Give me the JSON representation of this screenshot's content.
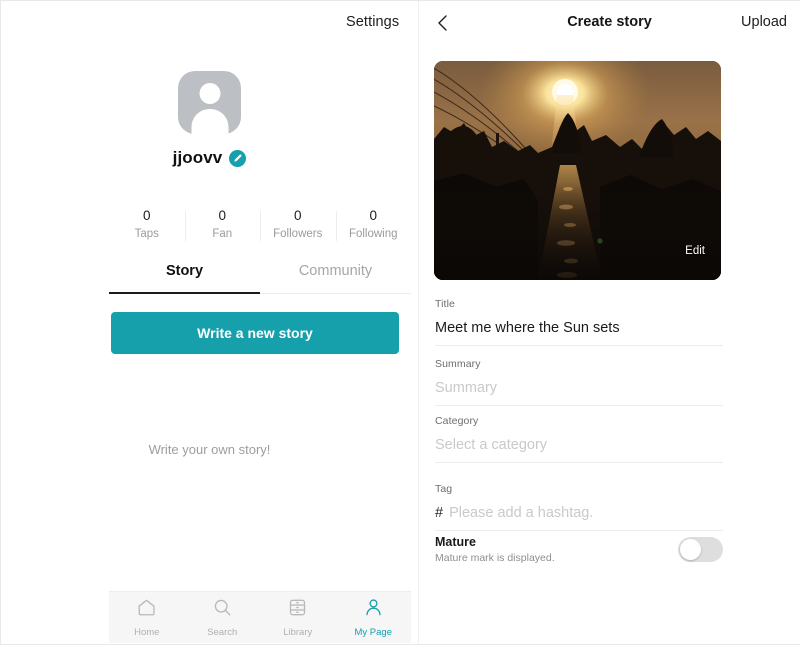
{
  "left": {
    "settings_label": "Settings",
    "profile": {
      "username": "jjoovv",
      "edit_badge_icon": "pencil-icon",
      "avatar_icon": "person-placeholder-icon"
    },
    "stats": [
      {
        "value": "0",
        "label": "Taps"
      },
      {
        "value": "0",
        "label": "Fan"
      },
      {
        "value": "0",
        "label": "Followers"
      },
      {
        "value": "0",
        "label": "Following"
      }
    ],
    "tabs": [
      {
        "label": "Story",
        "active": true
      },
      {
        "label": "Community",
        "active": false
      }
    ],
    "write_story_button": "Write a new story",
    "empty_message": "Write your own story!",
    "bottom_nav": [
      {
        "label": "Home",
        "icon": "home-icon",
        "active": false
      },
      {
        "label": "Search",
        "icon": "search-icon",
        "active": false
      },
      {
        "label": "Library",
        "icon": "library-icon",
        "active": false
      },
      {
        "label": "My Page",
        "icon": "person-icon",
        "active": true
      }
    ]
  },
  "right": {
    "back_icon": "chevron-left-icon",
    "title": "Create story",
    "upload_label": "Upload",
    "cover": {
      "edit_label": "Edit",
      "description": "sunset-photo"
    },
    "fields": {
      "title": {
        "label": "Title",
        "value": "Meet me where the Sun sets",
        "placeholder": ""
      },
      "summary": {
        "label": "Summary",
        "value": "",
        "placeholder": "Summary"
      },
      "category": {
        "label": "Category",
        "value": "",
        "placeholder": "Select a category"
      },
      "tag": {
        "label": "Tag",
        "value": "",
        "placeholder": "Please add a hashtag.",
        "prefix": "#"
      }
    },
    "mature": {
      "title": "Mature",
      "description": "Mature mark is displayed.",
      "enabled": false
    }
  },
  "colors": {
    "accent": "#16a0ac",
    "text": "#1b1b1b",
    "muted": "#9b9b9b",
    "placeholder": "#c9c9c9",
    "nav_bg": "#f6f6f7"
  }
}
